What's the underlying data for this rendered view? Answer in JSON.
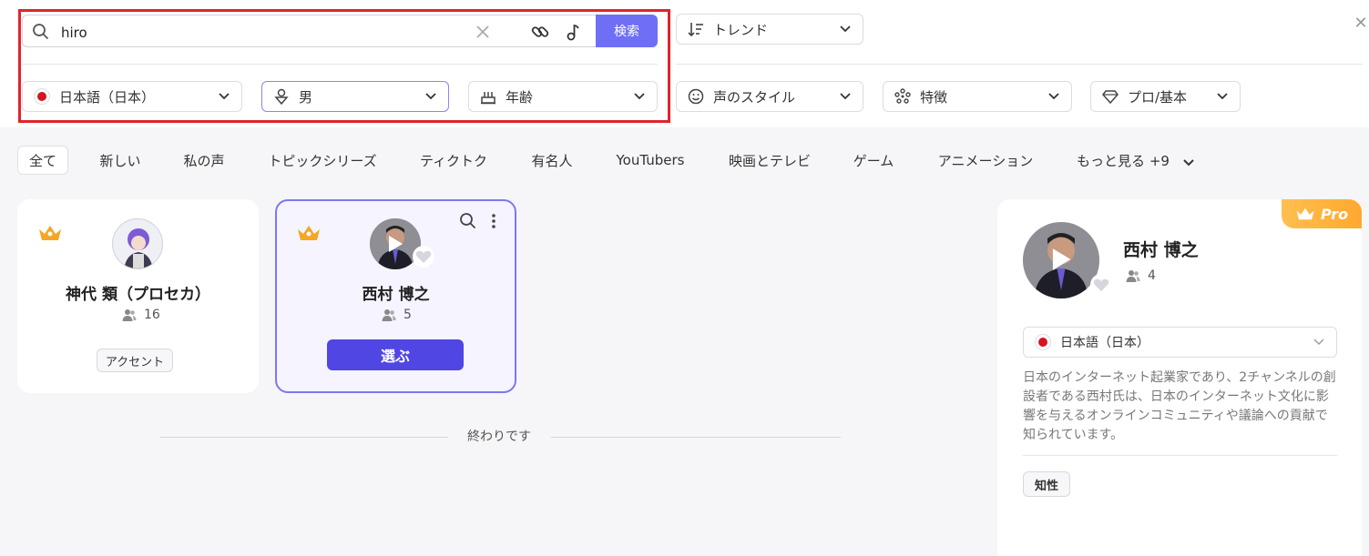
{
  "search": {
    "value": "hiro",
    "button_label": "検索"
  },
  "sort": {
    "label": "トレンド"
  },
  "filters": {
    "language": "日本語（日本）",
    "gender": "男",
    "age": "年齢",
    "style": "声のスタイル",
    "features": "特徴",
    "tier": "プロ/基本"
  },
  "tabs": [
    "全て",
    "新しい",
    "私の声",
    "トピックシリーズ",
    "ティクトク",
    "有名人",
    "YouTubers",
    "映画とテレビ",
    "ゲーム",
    "アニメーション",
    "もっと見る +9"
  ],
  "cards": [
    {
      "name": "神代 類（プロセカ）",
      "count": "16",
      "tag": "アクセント"
    },
    {
      "name": "西村 博之",
      "count": "5",
      "button": "選ぶ"
    }
  ],
  "end_text": "終わりです",
  "detail": {
    "badge": "Pro",
    "name": "西村 博之",
    "count": "4",
    "language": "日本語（日本）",
    "description": "日本のインターネット起業家であり、2チャンネルの創設者である西村氏は、日本のインターネット文化に影響を与えるオンラインコミュニティや議論への貢献で知られています。",
    "tag": "知性"
  },
  "colors": {
    "accent": "#5046e4",
    "search_button": "#6f6ff6",
    "highlight": "#e0242b",
    "pro": "#ffa82e",
    "crown": "#f5a623"
  },
  "icons": [
    "search-icon",
    "clear-icon",
    "link-icon",
    "music-note-icon",
    "sort-icon",
    "chevron-down-icon",
    "gender-icon",
    "age-icon",
    "smile-icon",
    "features-icon",
    "diamond-icon",
    "close-icon",
    "crown-icon",
    "users-icon",
    "play-icon",
    "heart-icon",
    "more-icon"
  ]
}
